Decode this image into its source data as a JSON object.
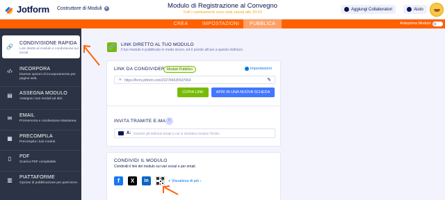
{
  "header": {
    "logo_text": "Jotform",
    "builder_menu": "Costruttore di Moduli",
    "form_title": "Modulo di Registrazione al Convegno",
    "save_status": "Tutti i cambiamenti sono stati salvati alle 20:03",
    "collaborators_label": "Aggiungi Collaboratori",
    "help_label": "Aiuto"
  },
  "nav": {
    "tabs": [
      {
        "label": "CREA"
      },
      {
        "label": "IMPOSTAZIONI"
      },
      {
        "label": "PUBBLICA"
      }
    ],
    "preview_label": "Anteprima Modulo"
  },
  "sidebar": {
    "items": [
      {
        "title": "CONDIVISIONE RAPIDA",
        "desc": "Link diretto al modulo e condivisione sui social.",
        "icon": "link-icon"
      },
      {
        "title": "INCORPORA",
        "desc": "Diverse opzioni di incorporamento per pagine web.",
        "icon": "code-icon"
      },
      {
        "title": "ASSEGNA MODULO",
        "desc": "Assegna i tuoi moduli ad altri.",
        "icon": "assign-icon"
      },
      {
        "title": "EMAIL",
        "desc": "Promemoria e condivisione istantanea.",
        "icon": "email-icon"
      },
      {
        "title": "PRECOMPILA",
        "desc": "Precompila i tuoi moduli.",
        "icon": "prefill-icon"
      },
      {
        "title": "PDF",
        "desc": "Scarica PDF compilabile.",
        "icon": "pdf-icon"
      },
      {
        "title": "PIATTAFORME",
        "desc": "Opzioni di pubblicazione per parti terze.",
        "icon": "platforms-icon"
      }
    ]
  },
  "direct_link": {
    "title": "LINK DIRETTO AL TUO MODULO",
    "subtitle": "Il tuo modulo è pubblicato in modo sicuro, ed è pronto all'uso a questo indirizzo."
  },
  "share_link": {
    "label": "LINK DA CONDIVIDERE",
    "badge": "Modulo Pubblico",
    "settings": "Impostazioni",
    "url": "https://form.jotform.com/232784635597064",
    "copy_button": "COPIA LINK",
    "open_button": "APRI IN UNA NUOVA SCHEDA"
  },
  "invite": {
    "label": "INVITA TRAMITE E-MAIL",
    "to_label": "A:",
    "placeholder": "Inserire gli indirizzi email a cui si desidera inviare l'invito."
  },
  "share_form": {
    "title": "CONDIVIDI IL MODULO",
    "subtitle": "Condividi il link del modulo sui vari social e per email.",
    "more": "+ Visualizza di più ›",
    "socials": [
      {
        "name": "facebook",
        "glyph": "f",
        "color": "#1877f2"
      },
      {
        "name": "x",
        "glyph": "X",
        "color": "#000000"
      },
      {
        "name": "linkedin",
        "glyph": "in",
        "color": "#0a66c2"
      }
    ]
  },
  "colors": {
    "accent_orange": "#ff6100",
    "green": "#78bb07",
    "blue": "#4277ff",
    "sidebar": "#2c3345"
  }
}
